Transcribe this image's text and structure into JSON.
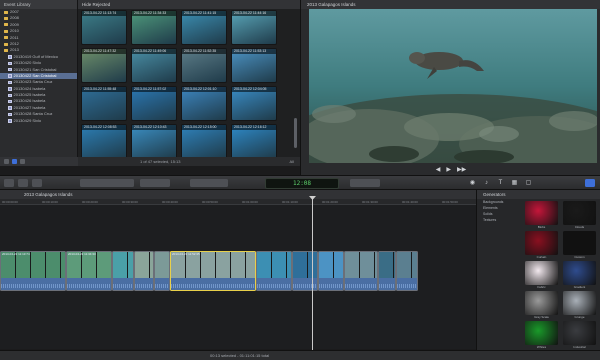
{
  "library": {
    "title": "Event Library",
    "items": [
      {
        "label": "2007",
        "kind": "folder",
        "indent": false,
        "selected": false
      },
      {
        "label": "2008",
        "kind": "folder",
        "indent": false,
        "selected": false
      },
      {
        "label": "2009",
        "kind": "folder",
        "indent": false,
        "selected": false
      },
      {
        "label": "2010",
        "kind": "folder",
        "indent": false,
        "selected": false
      },
      {
        "label": "2011",
        "kind": "folder",
        "indent": false,
        "selected": false
      },
      {
        "label": "2012",
        "kind": "folder",
        "indent": false,
        "selected": false
      },
      {
        "label": "2013",
        "kind": "folder",
        "indent": false,
        "selected": false
      },
      {
        "label": "20130419 Gulf of Mexico",
        "kind": "event",
        "indent": true,
        "selected": false
      },
      {
        "label": "20130420 Sixlo",
        "kind": "event",
        "indent": true,
        "selected": false
      },
      {
        "label": "20130421 San Cristobal",
        "kind": "event",
        "indent": true,
        "selected": false
      },
      {
        "label": "20130422 San Cristobal",
        "kind": "event",
        "indent": true,
        "selected": true
      },
      {
        "label": "20130423 Santa Cruz",
        "kind": "event",
        "indent": true,
        "selected": false
      },
      {
        "label": "20130424 Isabela",
        "kind": "event",
        "indent": true,
        "selected": false
      },
      {
        "label": "20130425 Isabela",
        "kind": "event",
        "indent": true,
        "selected": false
      },
      {
        "label": "20130426 Isabela",
        "kind": "event",
        "indent": true,
        "selected": false
      },
      {
        "label": "20130427 Isabela",
        "kind": "event",
        "indent": true,
        "selected": false
      },
      {
        "label": "20130428 Santa Cruz",
        "kind": "event",
        "indent": true,
        "selected": false
      },
      {
        "label": "20130429 Sixlo",
        "kind": "event",
        "indent": true,
        "selected": false
      }
    ]
  },
  "browser": {
    "filter": "Hide Rejected",
    "status": "1 of 47 selected, 15:13",
    "all_label": "All",
    "thumbnails": [
      {
        "meta": "2013-04-22 11:13:74",
        "color": "#3d7f8a"
      },
      {
        "meta": "2013-04-22 11:34:33",
        "color": "#4f9a7c"
      },
      {
        "meta": "2013-04-22 11:41:15",
        "color": "#3c8fb3"
      },
      {
        "meta": "2013-04-22 11:44:16",
        "color": "#5aa6b9"
      },
      {
        "meta": "2013-04-22 11:47:32",
        "color": "#6e8f6a"
      },
      {
        "meta": "2013-04-22 11:49:06",
        "color": "#4a8fa6"
      },
      {
        "meta": "2013-04-22 11:52:35",
        "color": "#5d7d88"
      },
      {
        "meta": "2013-04-22 11:53:13",
        "color": "#4c93c4"
      },
      {
        "meta": "2013-04-22 11:55:48",
        "color": "#2f6f9a"
      },
      {
        "meta": "2013-04-22 11:57:02",
        "color": "#2b78b4"
      },
      {
        "meta": "2013-04-22 12:01:10",
        "color": "#3d86c0"
      },
      {
        "meta": "2013-04-22 12:04:05",
        "color": "#3a8dc7"
      },
      {
        "meta": "2013-04-22 12:08:53",
        "color": "#2c7fb6"
      },
      {
        "meta": "2013-04-22 12:10:43",
        "color": "#3b8fc4"
      },
      {
        "meta": "2013-04-22 12:15:00",
        "color": "#2f83bd"
      },
      {
        "meta": "2013-04-22 12:16:12",
        "color": "#2e8ac9"
      }
    ]
  },
  "viewer": {
    "title": "2013 Galapagos Islands"
  },
  "toolbar": {
    "timecode": "12:08"
  },
  "timeline": {
    "title": "2013 Galapagos Islands",
    "ruler_labels": [
      "00:00:00:00",
      "00:00:10:00",
      "00:00:20:00",
      "00:00:30:00",
      "00:00:40:00",
      "00:00:50:00",
      "00:01:00:00",
      "00:01:10:00",
      "00:01:20:00",
      "00:01:30:00",
      "00:01:40:00",
      "00:01:50:00"
    ],
    "clips": [
      {
        "label": "2013-04-22 11:13:74",
        "color": "#4c8d6c",
        "selected": false
      },
      {
        "label": "2013-04-22 11:34:33",
        "color": "#5d9b7a",
        "selected": false
      },
      {
        "label": "",
        "color": "#4aa0a8",
        "selected": false
      },
      {
        "label": "",
        "color": "#8aa59a",
        "selected": false
      },
      {
        "label": "",
        "color": "#7c9a98",
        "selected": false
      },
      {
        "label": "2013-04-22 11:52:35",
        "color": "#8aa2a0",
        "selected": true
      },
      {
        "label": "",
        "color": "#3c8fb3",
        "selected": false
      },
      {
        "label": "",
        "color": "#2f6f9a",
        "selected": false
      },
      {
        "label": "",
        "color": "#4c93c4",
        "selected": false
      },
      {
        "label": "",
        "color": "#6f8f9a",
        "selected": false
      },
      {
        "label": "",
        "color": "#3a6d86",
        "selected": false
      },
      {
        "label": "",
        "color": "#5b7f90",
        "selected": false
      }
    ]
  },
  "generators": {
    "title": "Generators",
    "categories": [
      "Backgrounds",
      "Elements",
      "Solids",
      "Textures"
    ],
    "tiles": [
      {
        "label": "Blobs",
        "color": "#c4163a"
      },
      {
        "label": "Clouds",
        "color": "#1a1a1a"
      },
      {
        "label": "Curtain",
        "color": "#8a1020"
      },
      {
        "label": "Custom",
        "color": "#111111"
      },
      {
        "label": "Fabric",
        "color": "#f2e8ee"
      },
      {
        "label": "Gradient",
        "color": "#2f4c8e"
      },
      {
        "label": "Gray Scale",
        "color": "#9a9a9a"
      },
      {
        "label": "Grunge",
        "color": "#a9b0b8"
      },
      {
        "label": "Whites",
        "color": "#1a9a2a"
      },
      {
        "label": "Industrial",
        "color": "#3a3c40"
      }
    ]
  },
  "status": {
    "info": "00:13 selected - 01:11:01:15 total"
  }
}
